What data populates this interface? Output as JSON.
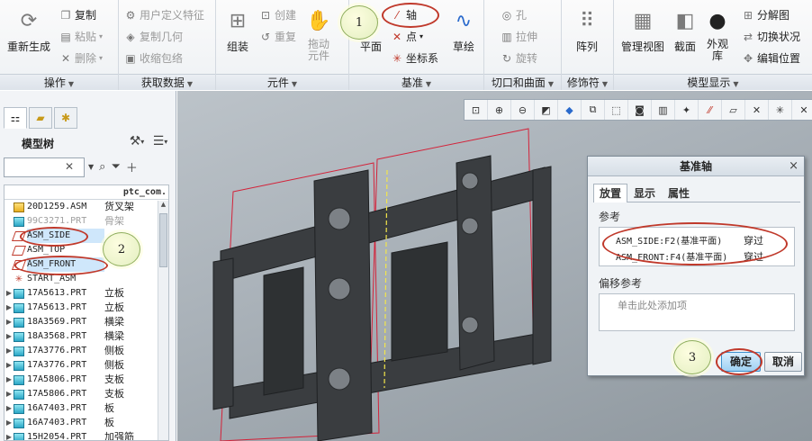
{
  "ribbon": {
    "groups": [
      {
        "label": "操作",
        "regen": "重新生成",
        "copy": "复制",
        "paste": "粘贴",
        "delete": "删除"
      },
      {
        "label": "获取数据",
        "udf": "用户定义特征",
        "copy_geom": "复制几何",
        "shrinkwrap": "收缩包络"
      },
      {
        "label": "元件",
        "assemble": "组装",
        "create": "创建",
        "repeat": "重复",
        "drag": "拖动元件"
      },
      {
        "label": "基准",
        "plane": "平面",
        "axis": "轴",
        "point": "点",
        "csys": "坐标系",
        "sketch": "草绘"
      },
      {
        "label": "切口和曲面",
        "hole": "孔",
        "extrude": "拉伸",
        "revolve": "旋转"
      },
      {
        "label": "修饰符",
        "pattern": "阵列"
      },
      {
        "label": "模型显示",
        "manage_views": "管理视图",
        "section": "截面",
        "appearance": "外观库",
        "explode": "分解图",
        "toggle_state": "切换状况",
        "edit_pos": "编辑位置"
      }
    ]
  },
  "left_panel": {
    "title": "模型树",
    "column_header": "ptc_com.",
    "filter_placeholder": "",
    "tree": [
      {
        "name": "20D1259.ASM",
        "desc": "货叉架",
        "type": "asm",
        "expand": ""
      },
      {
        "name": "99C3271.PRT",
        "desc": "骨架",
        "type": "part",
        "expand": "",
        "gray": true
      },
      {
        "name": "ASM_SIDE",
        "desc": "",
        "type": "plane",
        "expand": "",
        "selected": true
      },
      {
        "name": "ASM_TOP",
        "desc": "",
        "type": "plane",
        "expand": ""
      },
      {
        "name": "ASM_FRONT",
        "desc": "",
        "type": "plane",
        "expand": "",
        "selected": true
      },
      {
        "name": "START_ASM",
        "desc": "",
        "type": "csys",
        "expand": ""
      },
      {
        "name": "17A5613.PRT",
        "desc": "立板",
        "type": "part",
        "expand": "▶"
      },
      {
        "name": "17A5613.PRT",
        "desc": "立板",
        "type": "part",
        "expand": "▶"
      },
      {
        "name": "18A3569.PRT",
        "desc": "横梁",
        "type": "part",
        "expand": "▶"
      },
      {
        "name": "18A3568.PRT",
        "desc": "横梁",
        "type": "part",
        "expand": "▶"
      },
      {
        "name": "17A3776.PRT",
        "desc": "侧板",
        "type": "part",
        "expand": "▶"
      },
      {
        "name": "17A3776.PRT",
        "desc": "侧板",
        "type": "part",
        "expand": "▶"
      },
      {
        "name": "17A5806.PRT",
        "desc": "支板",
        "type": "part",
        "expand": "▶"
      },
      {
        "name": "17A5806.PRT",
        "desc": "支板",
        "type": "part",
        "expand": "▶"
      },
      {
        "name": "16A7403.PRT",
        "desc": "板",
        "type": "part",
        "expand": "▶"
      },
      {
        "name": "16A7403.PRT",
        "desc": "板",
        "type": "part",
        "expand": "▶"
      },
      {
        "name": "15H2054.PRT",
        "desc": "加强筋",
        "type": "part",
        "expand": "▶"
      }
    ]
  },
  "dialog": {
    "title": "基准轴",
    "tabs": [
      "放置",
      "显示",
      "属性"
    ],
    "references_label": "参考",
    "references": [
      {
        "ref": "ASM_SIDE:F2(基准平面)",
        "constraint": "穿过"
      },
      {
        "ref": "ASM_FRONT:F4(基准平面)",
        "constraint": "穿过"
      }
    ],
    "offset_label": "偏移参考",
    "offset_placeholder": "单击此处添加项",
    "ok": "确定",
    "cancel": "取消",
    "close": "×"
  },
  "annotations": {
    "step1": "1",
    "step2": "2",
    "step3": "3"
  },
  "colors": {
    "accent_red": "#c0392b",
    "model_dark": "#3a3d40",
    "viewport_bg": "#aab2b9"
  }
}
